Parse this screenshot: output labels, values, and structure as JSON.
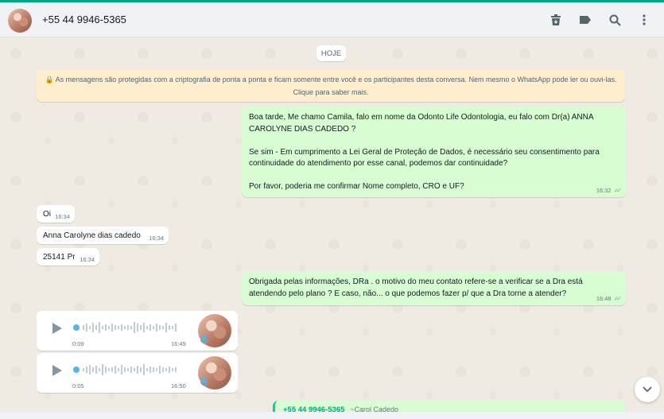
{
  "header": {
    "contact_name": "+55 44 9946-5365",
    "icons": [
      "archive-icon",
      "label-icon",
      "search-icon",
      "menu-icon"
    ]
  },
  "chat": {
    "date_chip": "HOJE",
    "encryption_notice": "🔒 As mensagens são protegidas com a criptografia de ponta a ponta e ficam somente entre você e os participantes desta conversa. Nem mesmo o WhatsApp pode ler ou ouvi-las. Clique para saber mais.",
    "messages": [
      {
        "text": "Boa tarde, Me chamo Camila, falo em nome da Odonto Life Odontologia, eu falo com Dr(a) ANNA CAROLYNE DIAS CADEDO ?\n\nSe sim - Em cumprimento a Lei Geral de Proteção de Dados, é necessário seu consentimento para continuidade do atendimento por esse canal, podemos dar continuidade?\n\nPor favor, poderia me confirmar Nome completo, CRO e UF?",
        "time": "16:32"
      },
      {
        "text": "Oi",
        "time": "16:34"
      },
      {
        "text": "Anna Carolyne dias cadedo",
        "time": "16:34"
      },
      {
        "text": "25141 Pr",
        "time": "16:34"
      },
      {
        "text": "Obrigada pelas informações, DRa . o motivo do meu contato refere-se a verificar se a Dra está atendendo pelo plano ? E caso, não... o que podemos fazer p/ que a Dra torne a atender?",
        "time": "16:48"
      }
    ],
    "audios": [
      {
        "duration": "0:09",
        "time": "16:49"
      },
      {
        "duration": "0:05",
        "time": "16:50"
      }
    ],
    "quoted": {
      "number": "+55 44 9946-5365",
      "alias": "~Carol Cadedo"
    }
  },
  "colors": {
    "accent": "#00a884",
    "outgoing": "#d9fdd3",
    "incoming": "#ffffff",
    "banner": "#ffeecd"
  }
}
